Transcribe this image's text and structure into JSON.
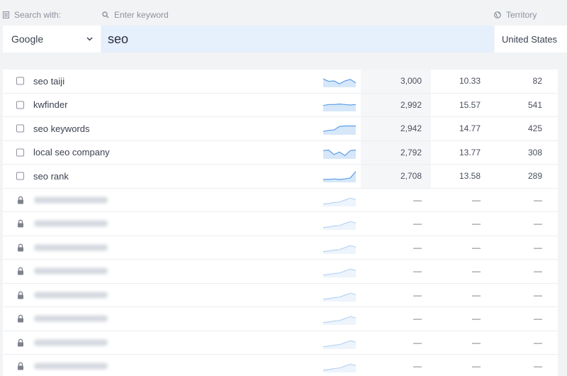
{
  "search": {
    "engine_label": "Search with:",
    "keyword_label": "Enter keyword",
    "territory_label": "Territory",
    "engine_value": "Google",
    "keyword_value": "seo",
    "territory_value": "United States"
  },
  "rows": [
    {
      "keyword": "seo taiji",
      "volume": "3,000",
      "cpc": "10.33",
      "difficulty": "82",
      "trend": [
        0.7,
        0.45,
        0.5,
        0.2,
        0.5,
        0.65,
        0.3
      ]
    },
    {
      "keyword": "kwfinder",
      "volume": "2,992",
      "cpc": "15.57",
      "difficulty": "541",
      "trend": [
        0.45,
        0.55,
        0.55,
        0.6,
        0.55,
        0.5,
        0.55
      ]
    },
    {
      "keyword": "seo keywords",
      "volume": "2,942",
      "cpc": "14.77",
      "difficulty": "425",
      "trend": [
        0.2,
        0.3,
        0.35,
        0.7,
        0.75,
        0.75,
        0.75
      ]
    },
    {
      "keyword": "local seo company",
      "volume": "2,792",
      "cpc": "13.77",
      "difficulty": "308",
      "trend": [
        0.7,
        0.75,
        0.3,
        0.55,
        0.2,
        0.7,
        0.75
      ]
    },
    {
      "keyword": "seo rank",
      "volume": "2,708",
      "cpc": "13.58",
      "difficulty": "289",
      "trend": [
        0.15,
        0.15,
        0.2,
        0.15,
        0.2,
        0.3,
        0.95
      ]
    },
    {
      "locked": true,
      "volume": "—",
      "cpc": "—",
      "difficulty": "—",
      "trend": [
        0.1,
        0.15,
        0.25,
        0.3,
        0.5,
        0.7,
        0.55
      ]
    },
    {
      "locked": true,
      "volume": "—",
      "cpc": "—",
      "difficulty": "—",
      "trend": [
        0.1,
        0.15,
        0.25,
        0.3,
        0.5,
        0.7,
        0.55
      ]
    },
    {
      "locked": true,
      "volume": "—",
      "cpc": "—",
      "difficulty": "—",
      "trend": [
        0.1,
        0.15,
        0.25,
        0.3,
        0.5,
        0.7,
        0.55
      ]
    },
    {
      "locked": true,
      "volume": "—",
      "cpc": "—",
      "difficulty": "—",
      "trend": [
        0.1,
        0.15,
        0.25,
        0.3,
        0.5,
        0.7,
        0.55
      ]
    },
    {
      "locked": true,
      "volume": "—",
      "cpc": "—",
      "difficulty": "—",
      "trend": [
        0.1,
        0.15,
        0.25,
        0.3,
        0.5,
        0.7,
        0.55
      ]
    },
    {
      "locked": true,
      "volume": "—",
      "cpc": "—",
      "difficulty": "—",
      "trend": [
        0.1,
        0.15,
        0.25,
        0.3,
        0.5,
        0.7,
        0.55
      ]
    },
    {
      "locked": true,
      "volume": "—",
      "cpc": "—",
      "difficulty": "—",
      "trend": [
        0.1,
        0.15,
        0.25,
        0.3,
        0.5,
        0.7,
        0.55
      ]
    },
    {
      "locked": true,
      "volume": "—",
      "cpc": "—",
      "difficulty": "—",
      "trend": [
        0.1,
        0.15,
        0.25,
        0.3,
        0.5,
        0.7,
        0.55
      ]
    }
  ],
  "colors": {
    "spark_line": "#5b9ee6",
    "spark_fill": "#d6e7fa",
    "locked_spark_line": "#b9d5f2",
    "locked_spark_fill": "#edf4fc",
    "keyword_input_bg": "#e6effc"
  }
}
